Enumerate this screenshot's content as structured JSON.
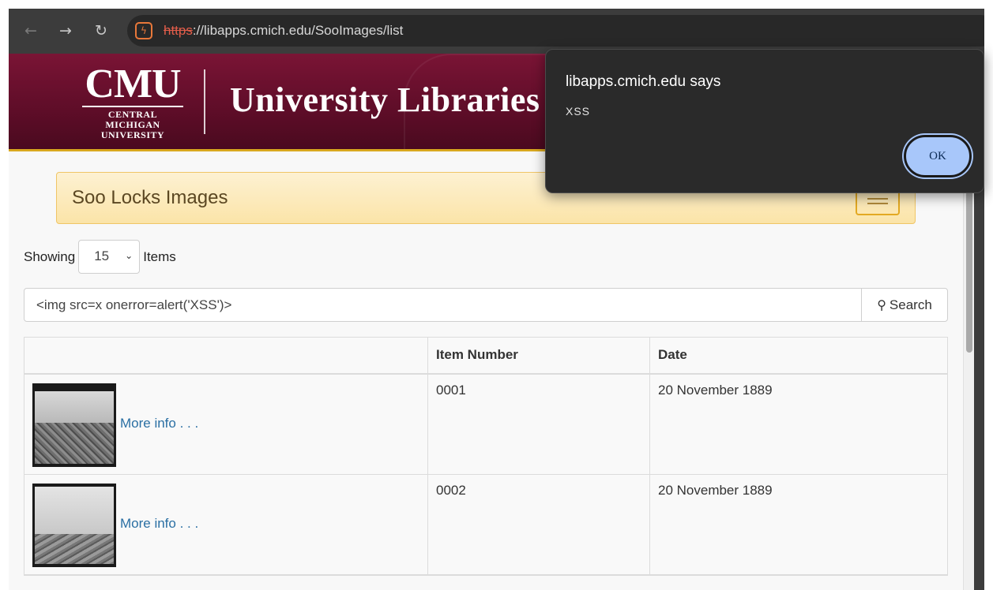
{
  "browser": {
    "url_scheme": "https",
    "url_rest": "://libapps.cmich.edu/SooImages/list",
    "back_icon": "←",
    "forward_icon": "→",
    "reload_icon": "↻",
    "site_info_icon": "ϟ"
  },
  "header": {
    "logo_big": "CMU",
    "logo_line1": "CENTRAL MICHIGAN",
    "logo_line2": "UNIVERSITY",
    "site_title": "University Libraries",
    "colors": {
      "maroon": "#6a0f2e",
      "gold": "#d9a81f"
    }
  },
  "navbar": {
    "brand": "Soo Locks Images"
  },
  "showing": {
    "label_before": "Showing",
    "selected": "15",
    "label_after": "Items"
  },
  "search": {
    "value": "<img src=x onerror=alert('XSS')>",
    "button_label": "Search",
    "button_icon": "🔍"
  },
  "table": {
    "headers": [
      "",
      "Item Number",
      "Date"
    ],
    "rows": [
      {
        "link": "More info . . .",
        "item_number": "0001",
        "date": "20 November 1889"
      },
      {
        "link": "More info . . .",
        "item_number": "0002",
        "date": "20 November 1889"
      }
    ]
  },
  "dialog": {
    "title": "libapps.cmich.edu says",
    "message": "XSS",
    "ok_label": "OK",
    "accent": "#a8c7fa"
  }
}
